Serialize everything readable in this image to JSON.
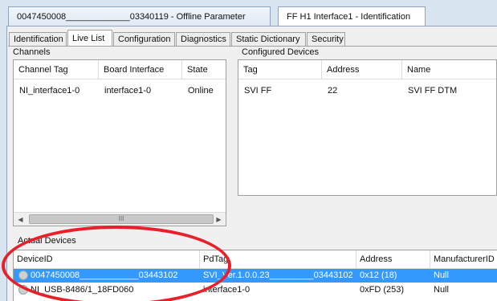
{
  "doc_tabs": [
    {
      "label": "0047450008_____________03340119 - Offline Parameter",
      "active": false
    },
    {
      "label": "FF H1 Interface1 - Identification",
      "active": true
    }
  ],
  "page_tabs": [
    {
      "label": "Identification",
      "active": false
    },
    {
      "label": "Live List",
      "active": true
    },
    {
      "label": "Configuration",
      "active": false
    },
    {
      "label": "Diagnostics",
      "active": false
    },
    {
      "label": "Static Dictionary",
      "active": false
    },
    {
      "label": "Security",
      "active": false
    }
  ],
  "channels": {
    "title": "Channels",
    "columns": [
      "Channel Tag",
      "Board Interface",
      "State"
    ],
    "rows": [
      [
        "NI_interface1-0",
        "interface1-0",
        "Online"
      ]
    ],
    "scroll_thumb_glyph": "III"
  },
  "configured_devices": {
    "title": "Configured Devices",
    "columns": [
      "Tag",
      "Address",
      "Name"
    ],
    "rows": [
      [
        "SVI FF",
        "22",
        "SVI FF DTM"
      ]
    ]
  },
  "actual_devices": {
    "title": "Actual Devices",
    "columns": [
      "DeviceID",
      "PdTag",
      "Address",
      "ManufacturerID"
    ],
    "rows": [
      {
        "device_id": "0047450008____________03443102",
        "pd_tag": "SVI_Ver.1.0.0.23_________03443102",
        "address": "0x12 (18)",
        "manufacturer": "Null",
        "selected": true
      },
      {
        "device_id": "NI_USB-8486/1_18FD060",
        "pd_tag": "interface1-0",
        "address": "0xFD (253)",
        "manufacturer": "Null",
        "selected": false
      }
    ]
  },
  "colors": {
    "selection": "#3399ff",
    "annotation": "#e8202a"
  },
  "icons": [
    "device-icon",
    "scroll-left-icon",
    "scroll-right-icon"
  ]
}
